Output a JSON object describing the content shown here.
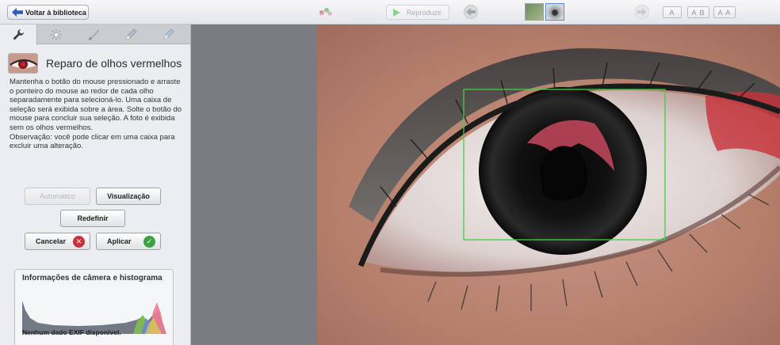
{
  "toolbar": {
    "back_label": "Voltar à biblioteca",
    "play_label": "Reproduzir",
    "view_single": "A",
    "view_split": "A B",
    "view_side": "A A",
    "colors": {
      "accent_blue": "#2f5bb7",
      "disabled_text": "#a9acb2"
    }
  },
  "panel": {
    "tabs": [
      {
        "icon": "wrench-icon",
        "active": true
      },
      {
        "icon": "sun-icon",
        "active": false
      },
      {
        "icon": "brush-icon",
        "active": false
      },
      {
        "icon": "pencil-eraser-icon",
        "active": false
      },
      {
        "icon": "pen-icon",
        "active": false
      }
    ],
    "tool_title": "Reparo de olhos vermelhos",
    "instructions": "Mantenha o botão do mouse pressionado e arraste o ponteiro do mouse ao redor de cada olho separadamente para selecioná-lo. Uma caixa de seleção será exibida sobre a área. Solte o botão do mouse para concluir sua seleção. A foto é exibida sem os olhos vermelhos.",
    "note": "Observação: você pode clicar em uma caixa para excluir uma alteração.",
    "buttons": {
      "auto": "Automático",
      "preview": "Visualização",
      "reset": "Redefinir",
      "cancel": "Cancelar",
      "apply": "Aplicar"
    },
    "info": {
      "title": "Informações de câmera e histograma",
      "no_exif": "Nenhum dado EXIF disponível."
    }
  }
}
